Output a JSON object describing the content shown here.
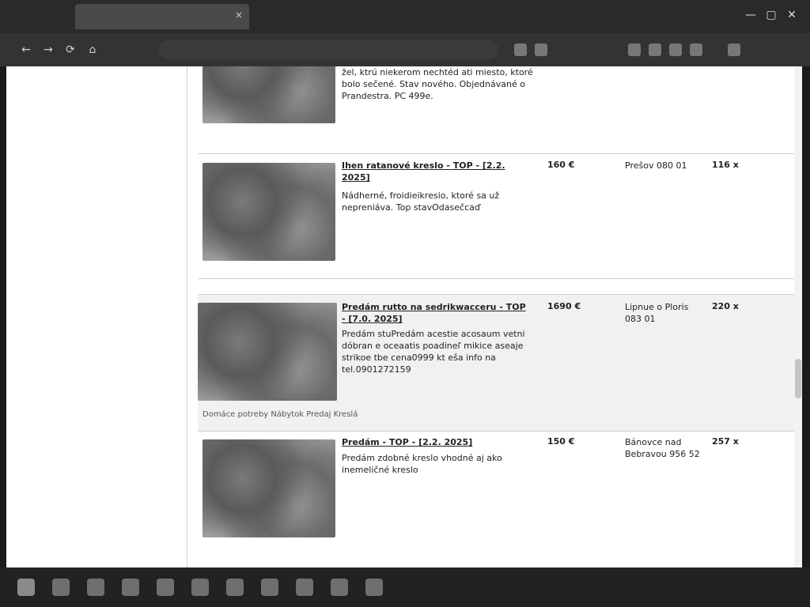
{
  "browser": {
    "tab_title": "",
    "tab_close": "×",
    "address": "",
    "nav": {
      "back": "←",
      "forward": "→",
      "reload": "⟳",
      "home": "⌂"
    },
    "window": {
      "minimize": "—",
      "maximize": "▢",
      "close": "✕"
    }
  },
  "listings": [
    {
      "title": "",
      "desc": "žel, ktrú niekerom nechtéd ati miesto, ktoré bolo sečené. Stav nového. Objednávané o Prandestra. PC 499e.",
      "price": "",
      "location": "",
      "distance": ""
    },
    {
      "title": "Ihen ratanové kreslo - TOP - [2.2. 2025]",
      "desc": "Nádherné, froidieikresio, ktoré sa už nepreniáva. Top stavOdasečcaď",
      "price": "160 €",
      "location": "Prešov 080 01",
      "distance": "116 x"
    },
    {
      "title": "Predám rutto na sedrikwacceru - TOP - [7.0. 2025]",
      "desc": "Predám stuPredám acestie acosaum vetni dóbran e oceaatis poadineľ mikice aseaje strikoe tbe cena0999 kt eša info na tel.0901272159",
      "price": "1690 €",
      "location": "Lipnue o Ploris 083 01",
      "distance": "220 x",
      "links": "Domáce potreby   Nábytok   Predaj   Kreslá"
    },
    {
      "title": "Predám - TOP - [2.2. 2025]",
      "desc": "Predám zdobné kreslo vhodné aj ako inemeličné kreslo",
      "price": "150 €",
      "location": "Bánovce nad Bebravou 956 52",
      "distance": "257 x"
    }
  ],
  "taskbar": {
    "tray_text": "",
    "icons": [
      "start-icon",
      "search-icon",
      "file-explorer-icon",
      "browser-icon",
      "store-icon",
      "mail-icon",
      "settings-icon",
      "folder-icon",
      "media-icon",
      "chat-icon",
      "photos-icon"
    ]
  }
}
